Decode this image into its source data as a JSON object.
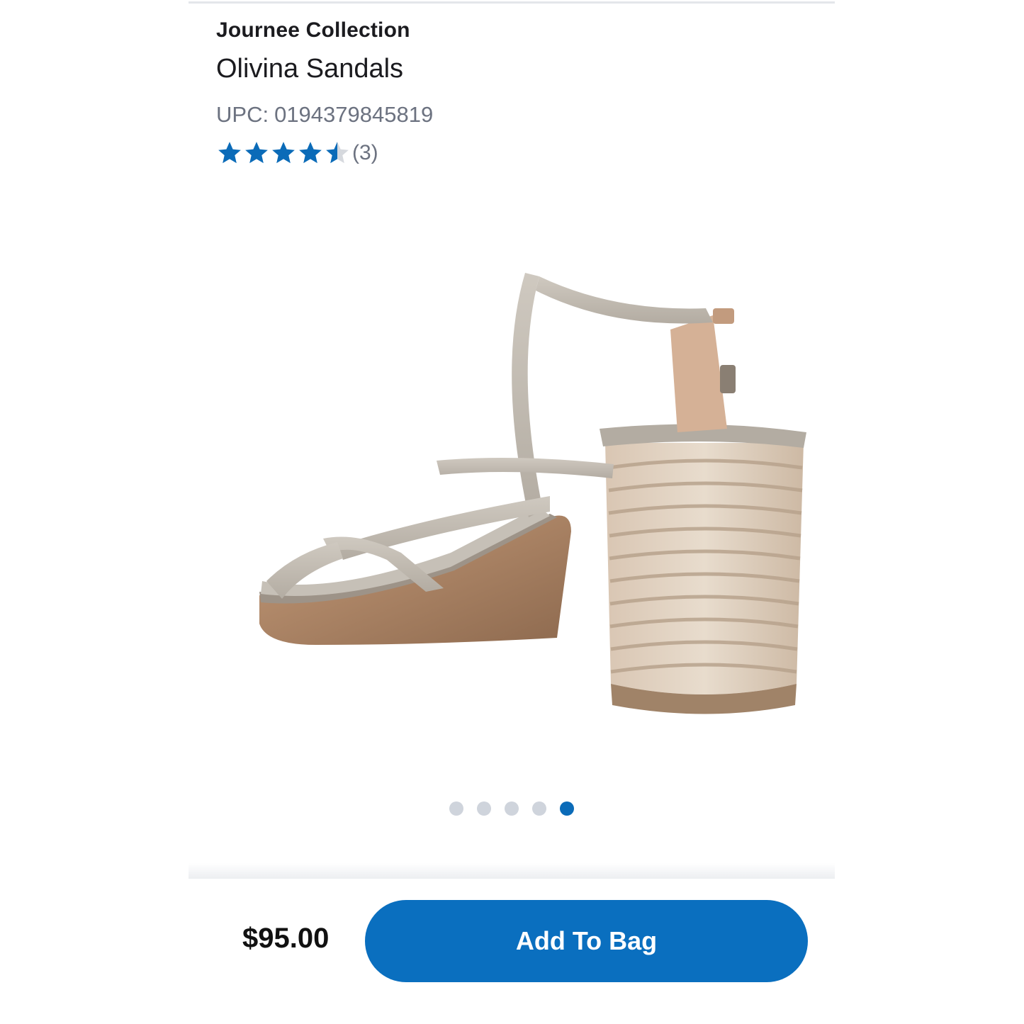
{
  "product": {
    "brand": "Journee Collection",
    "name": "Olivina Sandals",
    "upc_label": "UPC:",
    "upc_value": "0194379845819",
    "rating": 4.5,
    "rating_max": 5,
    "review_count": "(3)"
  },
  "gallery": {
    "image_icon": "sandal-product-image",
    "total_images": 5,
    "active_index": 4
  },
  "purchase_bar": {
    "price": "$95.00",
    "add_to_bag_label": "Add To Bag"
  },
  "colors": {
    "star": "#0b6bb8",
    "star_empty": "#d6d9de",
    "accent": "#0a6fbf",
    "dot_inactive": "#cfd4dc"
  }
}
